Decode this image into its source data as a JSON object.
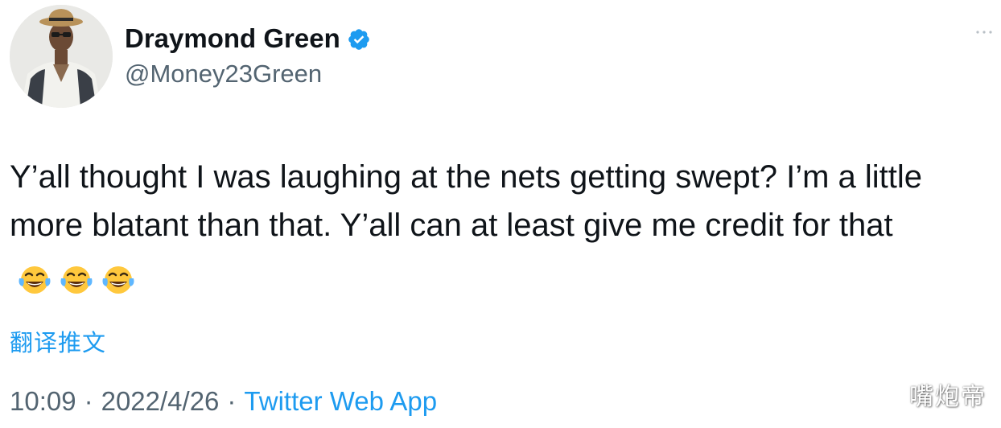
{
  "user": {
    "display_name": "Draymond Green",
    "handle": "@Money23Green",
    "verified_icon": "verified-badge-icon",
    "avatar_icon": "avatar-photo"
  },
  "tweet": {
    "text": "Y’all thought I was laughing at the nets getting swept? I’m a little more blatant than that. Y’all can at least give me credit for that",
    "emojis": [
      "face-with-tears-of-joy",
      "face-with-tears-of-joy",
      "face-with-tears-of-joy"
    ],
    "translate_label": "翻译推文"
  },
  "meta": {
    "time": "10:09",
    "separator": "·",
    "date": "2022/4/26",
    "source": "Twitter Web App"
  },
  "watermark": "嘴炮帝",
  "colors": {
    "link": "#1d9bf0",
    "secondary_text": "#536471",
    "primary_text": "#0f1419"
  }
}
